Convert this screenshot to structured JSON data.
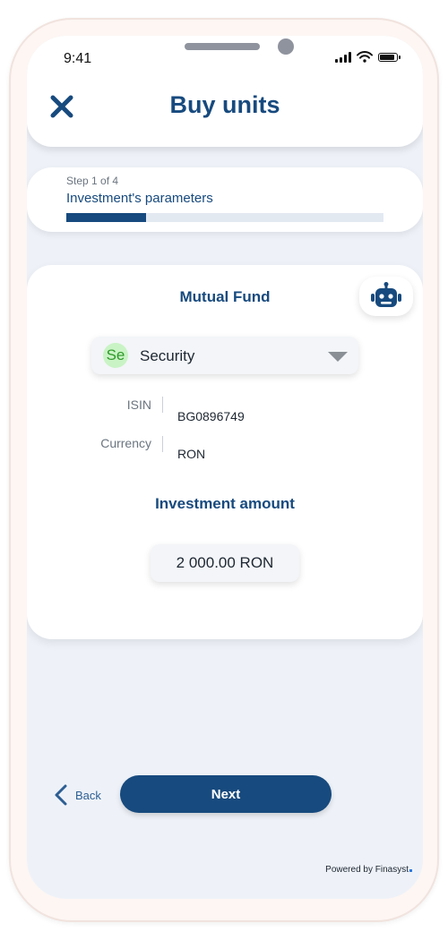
{
  "status_bar": {
    "time": "9:41"
  },
  "header": {
    "title": "Buy units",
    "close_icon": "close-icon"
  },
  "stepper": {
    "step_label": "Step 1 of 4",
    "step_title": "Investment's parameters",
    "progress": 0.25
  },
  "fund": {
    "title": "Mutual Fund",
    "assistant_icon": "robot-icon",
    "security": {
      "avatar_text": "Se",
      "label": "Security",
      "avatar_color": "#c9f3c5"
    },
    "details": [
      {
        "label": "ISIN",
        "value": "BG0896749"
      },
      {
        "label": "Currency",
        "value": "RON"
      }
    ]
  },
  "investment": {
    "title": "Investment amount",
    "amount": "2 000.00 RON"
  },
  "footer": {
    "back_label": "Back",
    "next_label": "Next",
    "powered_by": "Powered by Finasyst"
  },
  "colors": {
    "brand": "#174a7e",
    "background": "#eef2f8",
    "progress_track": "#e3e9f1"
  }
}
